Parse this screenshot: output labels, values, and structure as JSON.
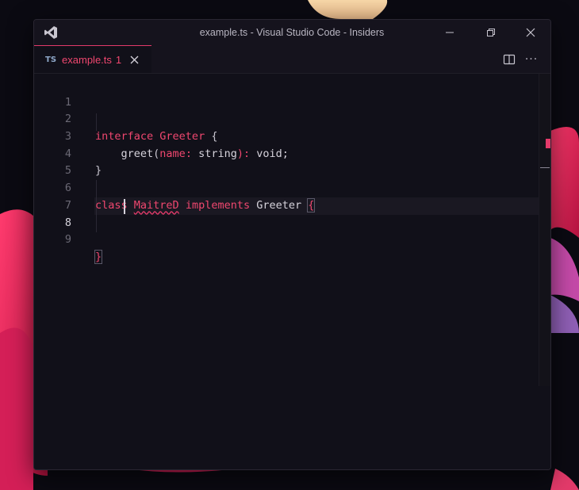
{
  "window": {
    "title": "example.ts - Visual Studio Code - Insiders",
    "app_icon": "vscode-insiders-logo-icon"
  },
  "tab": {
    "language_badge": "TS",
    "file_name": "example.ts",
    "problem_count": "1",
    "close_icon": "close-icon"
  },
  "editor": {
    "active_line": "8",
    "line_numbers": [
      "1",
      "2",
      "3",
      "4",
      "5",
      "6",
      "7",
      "8",
      "9"
    ],
    "code": {
      "l2_keyword": "interface",
      "l2_name": "Greeter",
      "l2_brace": "{",
      "l3_method": "greet",
      "l3_open": "(",
      "l3_param": "name",
      "l3_colon": ":",
      "l3_type": "string",
      "l3_close": "):",
      "l3_return": "void;",
      "l4_brace": "}",
      "l6_keyword": "class",
      "l6_name": "MaitreD",
      "l6_implements": "implements",
      "l6_interface": "Greeter",
      "l6_brace": "{",
      "l9_brace": "}"
    }
  },
  "colors": {
    "accent": "#f0476f",
    "background": "#111019"
  }
}
